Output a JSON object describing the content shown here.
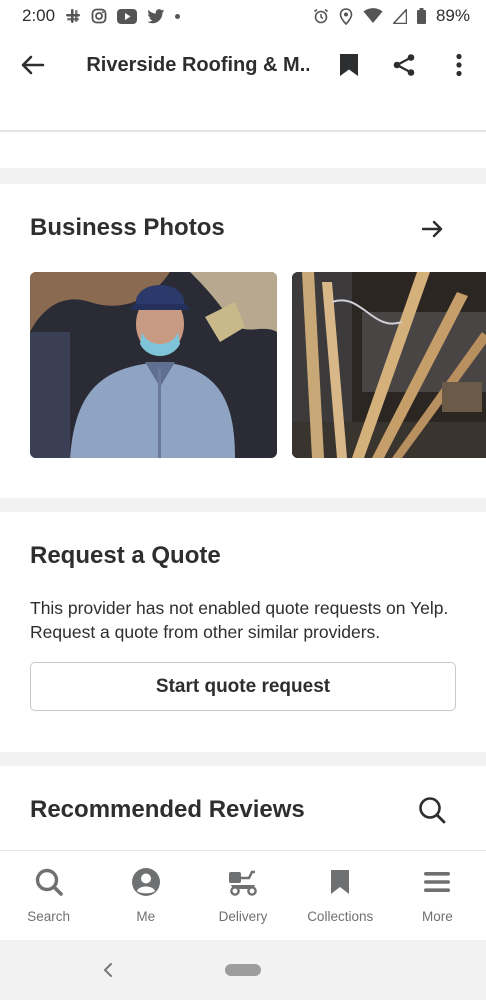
{
  "status_bar": {
    "time": "2:00",
    "battery": "89%",
    "icons": [
      "slack-icon",
      "instagram-icon",
      "youtube-icon",
      "twitter-icon",
      "dot-icon",
      "alarm-icon",
      "location-icon",
      "wifi-icon",
      "signal-icon",
      "battery-icon"
    ]
  },
  "app_bar": {
    "title": "Riverside Roofing & M...",
    "icons": [
      "back-arrow-icon",
      "bookmark-icon",
      "share-icon",
      "more-vertical-icon"
    ]
  },
  "photos": {
    "title": "Business Photos",
    "items": [
      "man-photo",
      "construction-photo"
    ]
  },
  "quote": {
    "title": "Request a Quote",
    "body": "This provider has not enabled quote requests on Yelp. Request a quote from other similar providers.",
    "button_label": "Start quote request"
  },
  "reviews": {
    "title": "Recommended Reviews"
  },
  "tabs": [
    {
      "label": "Search",
      "icon": "search-icon"
    },
    {
      "label": "Me",
      "icon": "user-icon"
    },
    {
      "label": "Delivery",
      "icon": "scooter-icon"
    },
    {
      "label": "Collections",
      "icon": "bookmark-icon"
    },
    {
      "label": "More",
      "icon": "menu-icon"
    }
  ],
  "colors": {
    "text": "#2d2e2f",
    "muted": "#6e7072",
    "background": "#f2f2f2",
    "surface": "#ffffff"
  }
}
